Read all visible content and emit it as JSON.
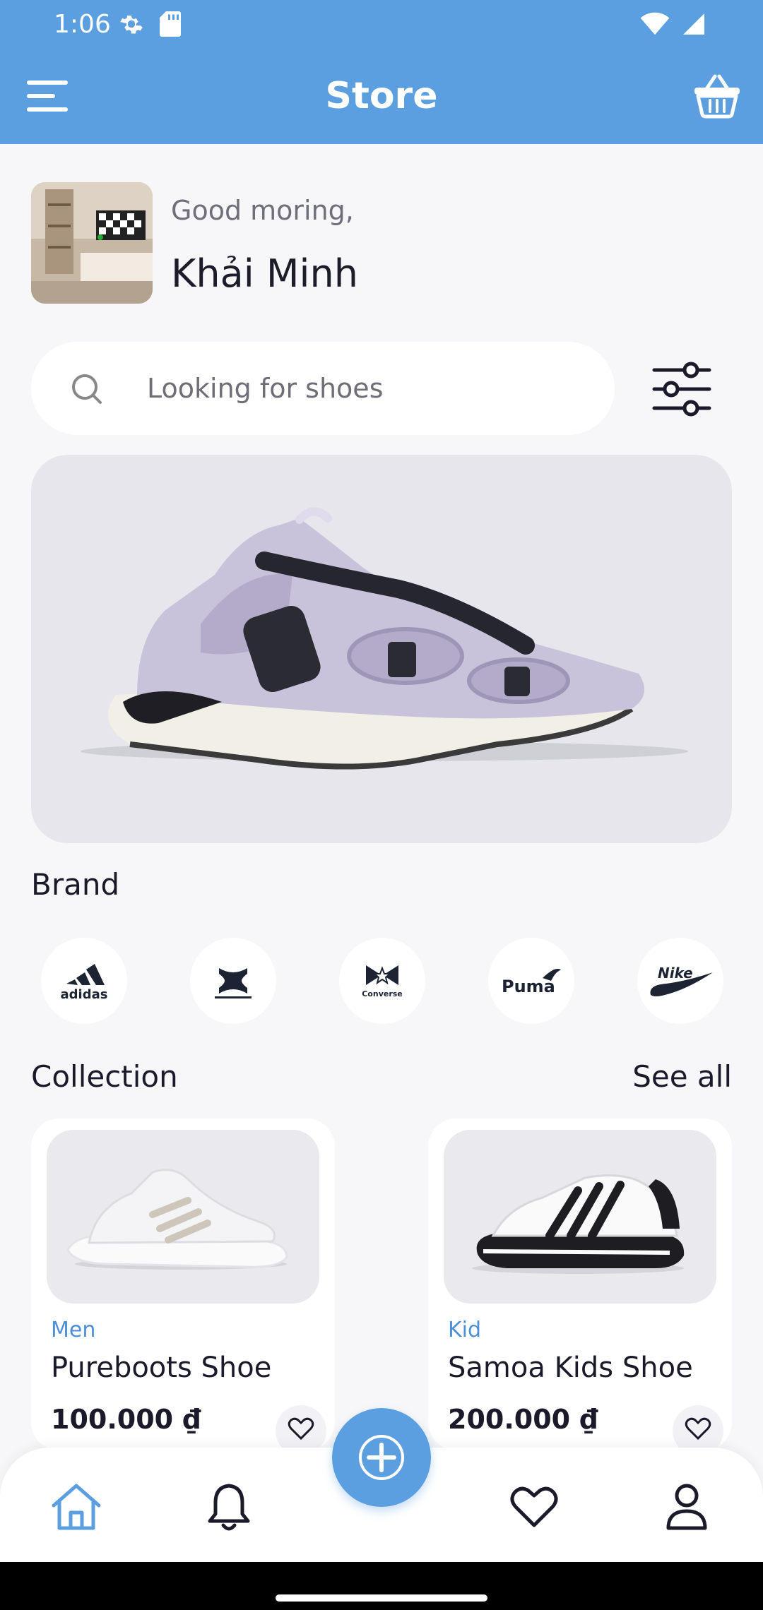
{
  "status_bar": {
    "time": "1:06"
  },
  "app_bar": {
    "title": "Store"
  },
  "greeting": {
    "text": "Good moring,",
    "name": "Khải Minh"
  },
  "search": {
    "placeholder": "Looking for shoes"
  },
  "brand_section": {
    "title": "Brand",
    "brands": [
      "adidas",
      "Under Armour",
      "Converse",
      "Puma",
      "Nike"
    ]
  },
  "collection": {
    "title": "Collection",
    "see_all": "See all",
    "products": [
      {
        "category": "Men",
        "name": "Pureboots Shoe",
        "price": "100.000 ₫"
      },
      {
        "category": "Kid",
        "name": "Samoa Kids Shoe",
        "price": "200.000 ₫"
      }
    ]
  },
  "colors": {
    "primary": "#5b9fe0",
    "background": "#f7f7f9",
    "accent_text": "#4d8fd6"
  }
}
